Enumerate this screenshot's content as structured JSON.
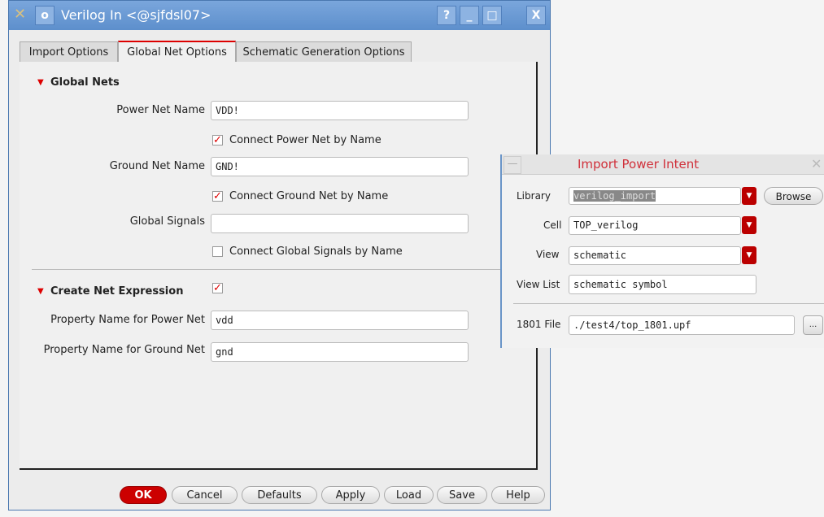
{
  "window": {
    "title": "Verilog In <@sjfdsl07>",
    "help": "?",
    "minimize": "_",
    "maximize": "□",
    "close": "X"
  },
  "tabs": [
    {
      "label": "Import Options"
    },
    {
      "label": "Global Net Options"
    },
    {
      "label": "Schematic Generation Options"
    }
  ],
  "global_nets": {
    "heading": "Global Nets",
    "power_label": "Power Net Name",
    "power_value": "VDD!",
    "connect_power": "Connect Power Net by Name",
    "connect_power_checked": true,
    "ground_label": "Ground Net Name",
    "ground_value": "GND!",
    "connect_ground": "Connect Ground Net by Name",
    "connect_ground_checked": true,
    "signals_label": "Global Signals",
    "signals_value": "",
    "connect_signals": "Connect Global Signals by Name",
    "connect_signals_checked": false
  },
  "net_expr": {
    "heading": "Create Net Expression",
    "checked": true,
    "power_label": "Property Name for Power Net",
    "power_value": "vdd",
    "ground_label": "Property Name for Ground Net",
    "ground_value": "gnd"
  },
  "buttons": {
    "ok": "OK",
    "cancel": "Cancel",
    "defaults": "Defaults",
    "apply": "Apply",
    "load": "Load",
    "save": "Save",
    "help": "Help"
  },
  "popup": {
    "title": "Import Power Intent",
    "library_label": "Library",
    "library_value": "verilog_import",
    "browse": "Browse",
    "cell_label": "Cell",
    "cell_value": "TOP_verilog",
    "view_label": "View",
    "view_value": "schematic",
    "viewlist_label": "View List",
    "viewlist_value": "schematic symbol",
    "file_label": "1801 File",
    "file_value": "./test4/top_1801.upf",
    "file_browse": "..."
  }
}
